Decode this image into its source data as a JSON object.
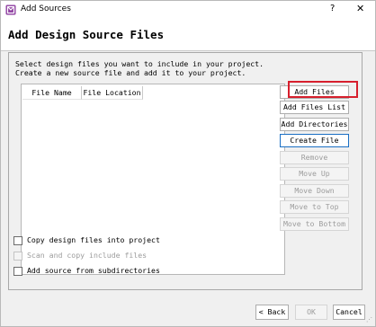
{
  "window": {
    "title": "Add Sources",
    "help_glyph": "?",
    "close_glyph": "✕",
    "icon": "vivado-logo-icon"
  },
  "header": {
    "title": "Add Design Source Files"
  },
  "description": {
    "line1": "Select design files you want to include in your project.",
    "line2": "Create a new source file and add it to your project."
  },
  "table": {
    "columns": [
      "File Name",
      "File Location"
    ]
  },
  "buttons": {
    "add_files": "Add Files",
    "add_files_list": "Add Files List",
    "add_directories": "Add Directories",
    "create_file": "Create File",
    "remove": "Remove",
    "move_up": "Move Up",
    "move_down": "Move Down",
    "move_to_top": "Move to Top",
    "move_to_bottom": "Move to Bottom"
  },
  "options": {
    "copy_files": "Copy design files into project",
    "scan_include": "Scan and copy include files",
    "add_subdirs": "Add source from subdirectories"
  },
  "footer": {
    "back": "< Back",
    "ok": "OK",
    "cancel": "Cancel"
  },
  "colors": {
    "highlight": "#d71f2d",
    "focus_border": "#1a6fc4"
  }
}
